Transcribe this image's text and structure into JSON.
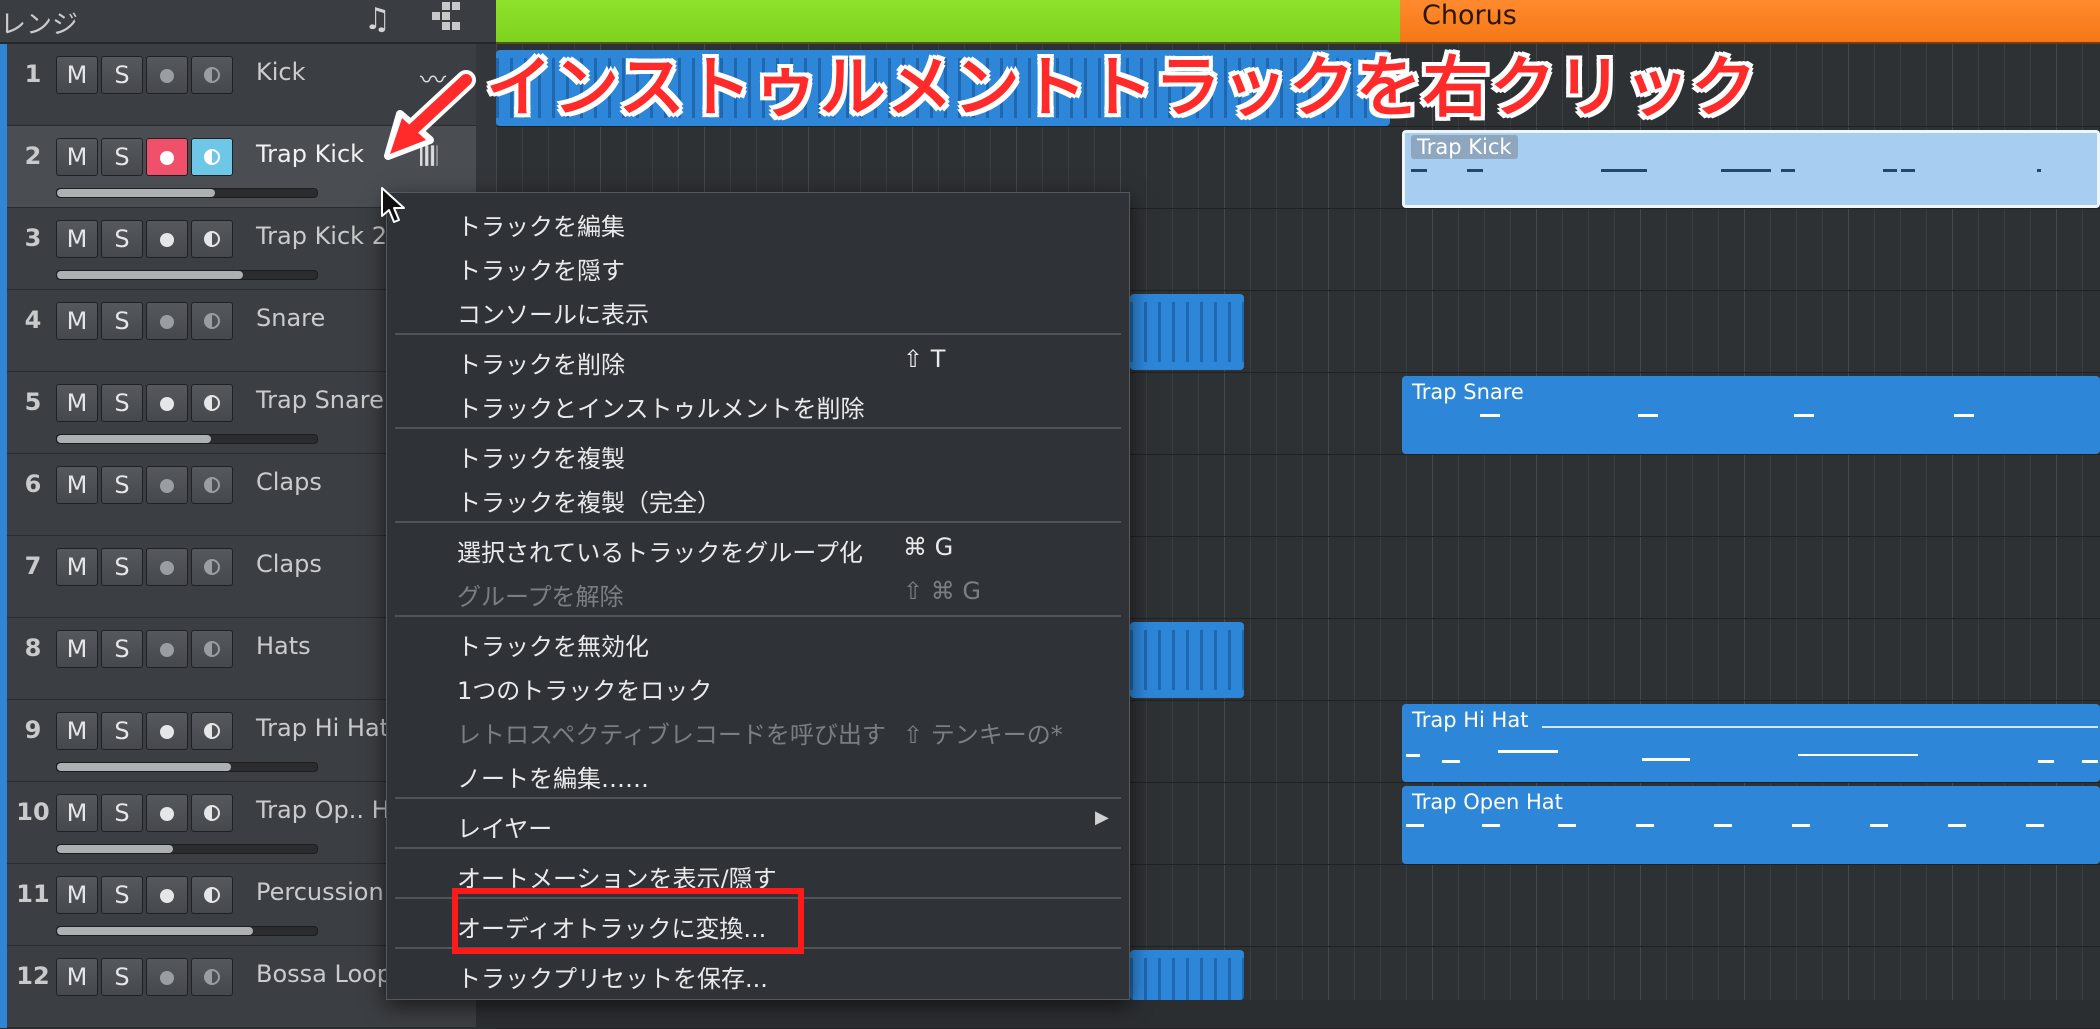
{
  "header": {
    "title": "レンジ",
    "note_icon": "music-note-icon",
    "grid_icon": "grid-icon"
  },
  "arrangement": {
    "chorus_label": "Chorus",
    "green_color": "#8ee22b",
    "orange_color": "#f57816"
  },
  "tracks": [
    {
      "num": "1",
      "name": "Kick",
      "m": "M",
      "s": "S"
    },
    {
      "num": "2",
      "name": "Trap Kick",
      "m": "M",
      "s": "S"
    },
    {
      "num": "3",
      "name": "Trap Kick 2",
      "m": "M",
      "s": "S"
    },
    {
      "num": "4",
      "name": "Snare",
      "m": "M",
      "s": "S"
    },
    {
      "num": "5",
      "name": "Trap Snare",
      "m": "M",
      "s": "S"
    },
    {
      "num": "6",
      "name": "Claps",
      "m": "M",
      "s": "S"
    },
    {
      "num": "7",
      "name": "Claps",
      "m": "M",
      "s": "S"
    },
    {
      "num": "8",
      "name": "Hats",
      "m": "M",
      "s": "S"
    },
    {
      "num": "9",
      "name": "Trap Hi Hat",
      "m": "M",
      "s": "S"
    },
    {
      "num": "10",
      "name": "Trap Op.. H",
      "m": "M",
      "s": "S"
    },
    {
      "num": "11",
      "name": "Percussion",
      "m": "M",
      "s": "S"
    },
    {
      "num": "12",
      "name": "Bossa Loop",
      "m": "M",
      "s": "S"
    }
  ],
  "clips": {
    "trap_kick": "Trap Kick",
    "trap_snare": "Trap Snare",
    "trap_hi_hat": "Trap Hi Hat",
    "trap_open_hat": "Trap Open Hat"
  },
  "menu": {
    "edit_track": "トラックを編集",
    "hide_track": "トラックを隠す",
    "show_in_console": "コンソールに表示",
    "delete_track": "トラックを削除",
    "delete_track_sc": "⇧ T",
    "delete_track_instrument": "トラックとインストゥルメントを削除",
    "duplicate_track": "トラックを複製",
    "duplicate_full": "トラックを複製（完全）",
    "group_selected": "選択されているトラックをグループ化",
    "group_selected_sc": "⌘ G",
    "ungroup": "グループを解除",
    "ungroup_sc": "⇧ ⌘ G",
    "disable_track": "トラックを無効化",
    "lock_track": "1つのトラックをロック",
    "retrospective": "レトロスペクティブレコードを呼び出す",
    "retrospective_sc": "⇧ テンキーの*",
    "edit_notes": "ノートを編集……",
    "layer": "レイヤー",
    "show_hide_automation": "オートメーションを表示/隠す",
    "convert_to_audio": "オーディオトラックに変換...",
    "save_track_preset": "トラックプリセットを保存..."
  },
  "annotation": {
    "callout": "インストゥルメントトラックを右クリック",
    "color": "#ff2a2a"
  }
}
